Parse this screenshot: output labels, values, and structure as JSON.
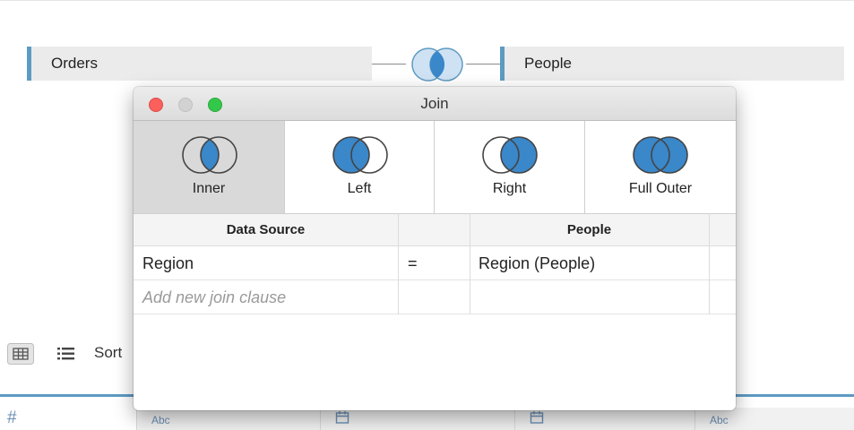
{
  "canvas": {
    "left_table": "Orders",
    "right_table": "People",
    "sort_label": "Sort",
    "column_types": [
      "#",
      "Abc",
      "Abc"
    ]
  },
  "dialog": {
    "title": "Join",
    "join_types": [
      {
        "label": "Inner",
        "selected": true
      },
      {
        "label": "Left",
        "selected": false
      },
      {
        "label": "Right",
        "selected": false
      },
      {
        "label": "Full Outer",
        "selected": false
      }
    ],
    "headers": {
      "left": "Data Source",
      "operator": "",
      "right": "People"
    },
    "clauses": [
      {
        "left": "Region",
        "operator": "=",
        "right": "Region (People)"
      }
    ],
    "add_clause_placeholder": "Add new join clause"
  },
  "colors": {
    "accent": "#3a87c9",
    "pill_bar": "#5d9bc2",
    "venn_light": "#c6dcf0"
  }
}
